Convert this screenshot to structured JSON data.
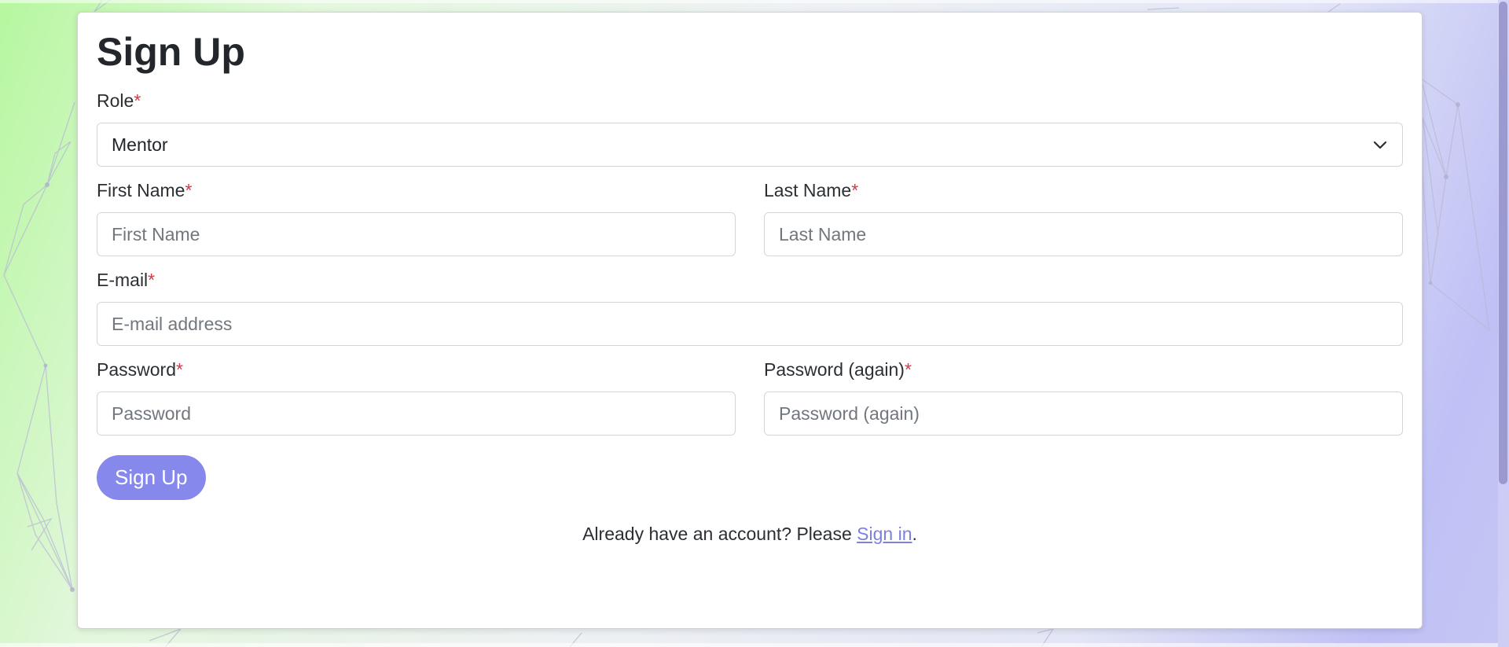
{
  "page": {
    "title": "Sign Up"
  },
  "form": {
    "role": {
      "label": "Role",
      "required_marker": "*",
      "selected": "Mentor"
    },
    "first_name": {
      "label": "First Name",
      "required_marker": "*",
      "placeholder": "First Name",
      "value": ""
    },
    "last_name": {
      "label": "Last Name",
      "required_marker": "*",
      "placeholder": "Last Name",
      "value": ""
    },
    "email": {
      "label": "E-mail",
      "required_marker": "*",
      "placeholder": "E-mail address",
      "value": ""
    },
    "password": {
      "label": "Password",
      "required_marker": "*",
      "placeholder": "Password",
      "value": ""
    },
    "password_again": {
      "label": "Password (again)",
      "required_marker": "*",
      "placeholder": "Password (again)",
      "value": ""
    },
    "submit_label": "Sign Up"
  },
  "footer": {
    "prefix": "Already have an account? Please ",
    "link_text": "Sign in",
    "suffix": "."
  },
  "icons": {
    "select_arrow": "chevron-down-icon"
  },
  "colors": {
    "primary": "#8688ec",
    "link": "#7c80df",
    "required": "#dc3545",
    "text": "#23262b"
  }
}
